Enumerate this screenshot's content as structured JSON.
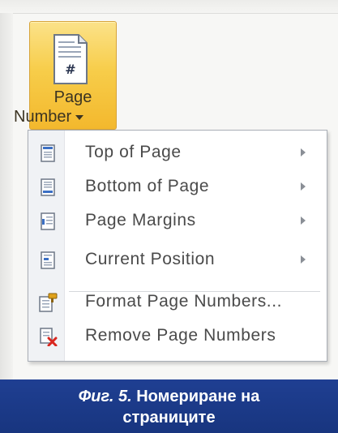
{
  "ribbon": {
    "button_line1": "Page",
    "button_line2": "Number"
  },
  "menu": {
    "items": [
      {
        "label": "Top of Page",
        "icon": "page-top-icon",
        "has_submenu": true
      },
      {
        "label": "Bottom of Page",
        "icon": "page-bottom-icon",
        "has_submenu": true
      },
      {
        "label": "Page Margins",
        "icon": "page-margins-icon",
        "has_submenu": true
      },
      {
        "label": "Current Position",
        "icon": "current-position-icon",
        "has_submenu": true
      },
      {
        "label": "Format Page Numbers...",
        "icon": "format-page-numbers-icon",
        "has_submenu": false
      },
      {
        "label": "Remove Page Numbers",
        "icon": "remove-page-numbers-icon",
        "has_submenu": false
      }
    ]
  },
  "caption": {
    "figure": "Фиг. 5.",
    "line1_rest": "Номериране на",
    "line2": "страниците"
  },
  "colors": {
    "button_highlight": "#f7cd4a",
    "caption_background": "#1f3f92",
    "remove_x": "#d9271f",
    "format_brush": "#e0a21a"
  }
}
